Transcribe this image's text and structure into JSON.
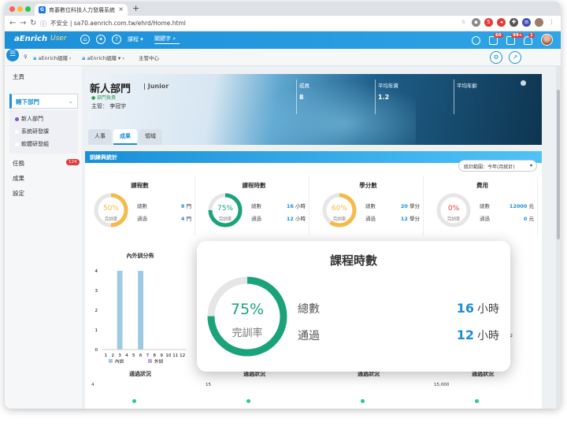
{
  "browser": {
    "tab_title": "育碁數位科技人力發展系統",
    "url": "sa70.aenrich.com.tw/ehrd/Home.html",
    "security": "不安全",
    "favicon": "G"
  },
  "appbar": {
    "brand": "aEnrich",
    "brand2": "User",
    "course_label": "課程",
    "search_placeholder": "關鍵字",
    "badges": [
      "60",
      "99+",
      "1"
    ]
  },
  "breadcrumb": {
    "org1": "aEnrich組織",
    "org2": "aEnrich組織",
    "current": "主管中心"
  },
  "sidebar": {
    "home": "主頁",
    "active": "轄下部門",
    "subs": [
      "新人部門",
      "系統研發課",
      "軟體研發組"
    ],
    "task": "任務",
    "task_badge": "124",
    "results": "成果",
    "settings": "設定"
  },
  "hero": {
    "title": "新人部門",
    "level": "Junior",
    "unit": "部門負責",
    "manager_label": "主管：",
    "manager": "李冠宇",
    "stats": [
      {
        "label": "成員",
        "value": "8"
      },
      {
        "label": "平均年資",
        "value": "1.2"
      },
      {
        "label": "平均年齡",
        "value": ""
      }
    ],
    "tabs": [
      "人事",
      "成果",
      "領域"
    ]
  },
  "panel": {
    "title": "訓練與統計",
    "range_label": "統計範圍：",
    "range_value": "今年(月統計)"
  },
  "cards": [
    {
      "title": "課程數",
      "percent": "50%",
      "rate_label": "完訓率",
      "total_label": "總數",
      "total": "8",
      "total_unit": "門",
      "pass_label": "通過",
      "pass": "4",
      "pass_unit": "門",
      "color": "#f6b94a",
      "frac": 0.5
    },
    {
      "title": "課程時數",
      "percent": "75%",
      "rate_label": "完訓率",
      "total_label": "總數",
      "total": "16",
      "total_unit": "小時",
      "pass_label": "通過",
      "pass": "12",
      "pass_unit": "小時",
      "color": "#1aa37a",
      "frac": 0.75
    },
    {
      "title": "學分數",
      "percent": "60%",
      "rate_label": "完訓率",
      "total_label": "總數",
      "total": "20",
      "total_unit": "學分",
      "pass_label": "通過",
      "pass": "12",
      "pass_unit": "學分",
      "color": "#f6b94a",
      "frac": 0.6
    },
    {
      "title": "費用",
      "percent": "0%",
      "rate_label": "完訓率",
      "total_label": "總數",
      "total": "12000",
      "total_unit": "元",
      "pass_label": "通過",
      "pass": "0",
      "pass_unit": "元",
      "color": "#e53935",
      "frac": 0
    }
  ],
  "chart_data": {
    "type": "bar",
    "title": "內外訓分佈",
    "categories": [
      "1",
      "2",
      "3",
      "4",
      "5",
      "6",
      "7",
      "8",
      "9",
      "10",
      "11",
      "12"
    ],
    "series": [
      {
        "name": "內訓",
        "values": [
          0,
          0,
          4,
          0,
          0,
          4,
          0,
          0,
          0,
          0,
          0,
          0
        ]
      },
      {
        "name": "外訓",
        "values": [
          0,
          0,
          0,
          0,
          0,
          0,
          0,
          0,
          0,
          0,
          0,
          0
        ]
      }
    ],
    "ylim": [
      0,
      4
    ],
    "yticks": [
      "0",
      "1",
      "2",
      "3",
      "4"
    ],
    "colors": [
      "#9ecae1",
      "#c3a6e0"
    ]
  },
  "right_chart_xticks": [
    "11",
    "12"
  ],
  "sections": [
    {
      "title": "通過狀況",
      "y": "4"
    },
    {
      "title": "通過狀況",
      "y": "15"
    },
    {
      "title": "通過狀況",
      "y": ""
    },
    {
      "title": "通過狀況",
      "y": "15,000"
    }
  ],
  "popup": {
    "title": "課程時數",
    "percent": "75%",
    "rate_label": "完訓率",
    "total_label": "總數",
    "total": "16",
    "unit": "小時",
    "pass_label": "通過",
    "pass": "12",
    "frac": 0.75
  }
}
